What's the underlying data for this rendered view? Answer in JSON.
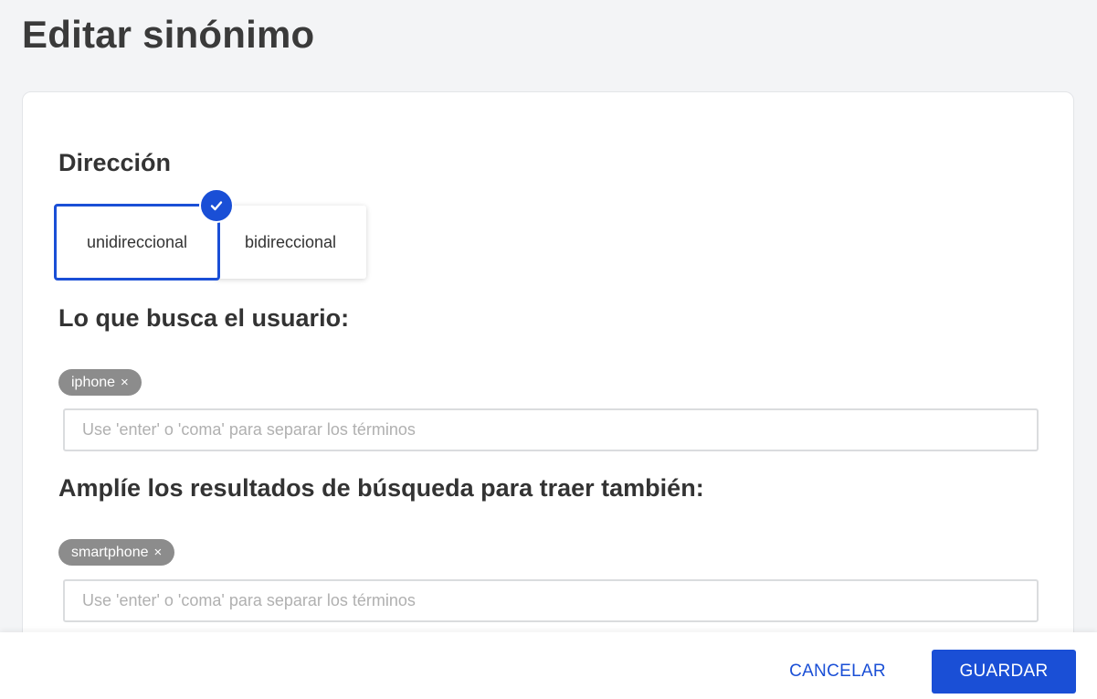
{
  "page": {
    "title": "Editar sinónimo"
  },
  "direction": {
    "title": "Dirección",
    "options": [
      {
        "label": "unidireccional",
        "selected": true
      },
      {
        "label": "bidireccional",
        "selected": false
      }
    ],
    "check_icon": "check-icon"
  },
  "search_terms": {
    "title": "Lo que busca el usuario:",
    "chips": [
      {
        "label": "iphone",
        "remove_icon": "×"
      }
    ],
    "input": {
      "value": "",
      "placeholder": "Use 'enter' o 'coma' para separar los términos"
    }
  },
  "expand_terms": {
    "title": "Amplíe los resultados de búsqueda para traer también:",
    "chips": [
      {
        "label": "smartphone",
        "remove_icon": "×"
      }
    ],
    "input": {
      "value": "",
      "placeholder": "Use 'enter' o 'coma' para separar los términos"
    }
  },
  "footer": {
    "cancel_label": "CANCELAR",
    "save_label": "GUARDAR"
  },
  "colors": {
    "accent": "#1a4fd6",
    "chip": "#8c8c8c",
    "background": "#f3f4f6"
  }
}
